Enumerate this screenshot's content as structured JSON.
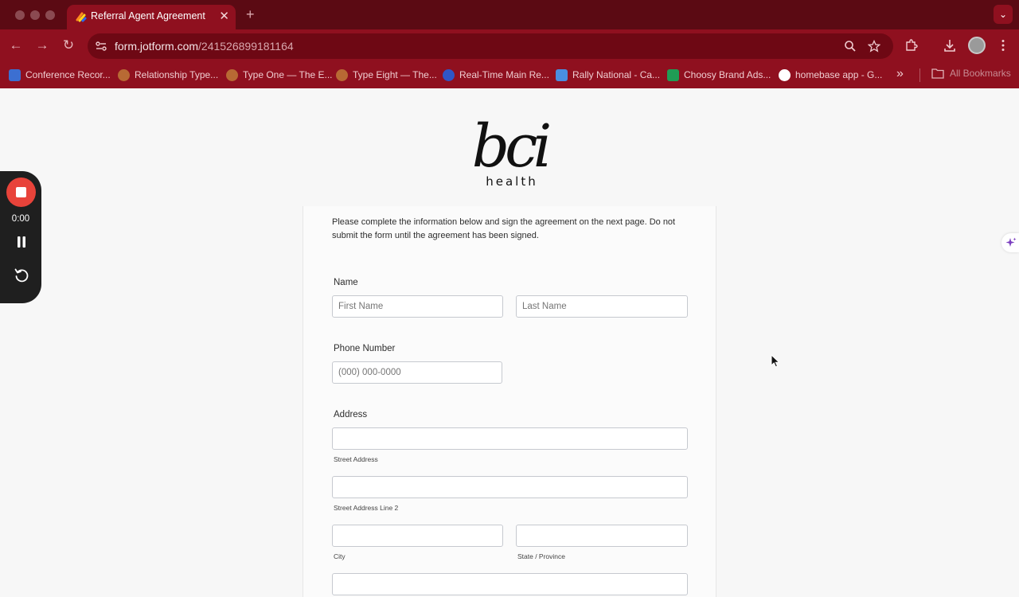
{
  "browser": {
    "tab_title": "Referral Agent Agreement",
    "tab_close": "✕",
    "new_tab": "+",
    "tab_menu": "⌄",
    "url_domain": "form.jotform.com",
    "url_path": "/241526899181164",
    "bookmarks": [
      {
        "label": "Conference Recor...",
        "color": "#3c6fd1"
      },
      {
        "label": "Relationship Type...",
        "color": "#b86a34"
      },
      {
        "label": "Type One — The E...",
        "color": "#b86a34"
      },
      {
        "label": "Type Eight — The...",
        "color": "#b86a34"
      },
      {
        "label": "Real-Time Main Re...",
        "color": "#2f56c6"
      },
      {
        "label": "Rally National - Ca...",
        "color": "#4a8ee0"
      },
      {
        "label": "Choosy Brand Ads...",
        "color": "#1f9d55"
      },
      {
        "label": "homebase app - G...",
        "color": "#ffffff"
      }
    ],
    "bookmarks_more": "»",
    "all_bookmarks": "All Bookmarks"
  },
  "logo": {
    "mark": "bci",
    "word": "health"
  },
  "form": {
    "intro": "Please complete the information below and sign the agreement on the next page. Do not submit the form until the agreement has been signed.",
    "name_label": "Name",
    "first_name_placeholder": "First Name",
    "last_name_placeholder": "Last Name",
    "phone_label": "Phone Number",
    "phone_placeholder": "(000) 000-0000",
    "address_label": "Address",
    "street_sub": "Street Address",
    "street2_sub": "Street Address Line 2",
    "city_sub": "City",
    "state_sub": "State / Province"
  },
  "recorder": {
    "time": "0:00"
  },
  "colors": {
    "chrome_dark": "#5b0a13",
    "chrome": "#8f101f",
    "record_red": "#e8433a"
  }
}
